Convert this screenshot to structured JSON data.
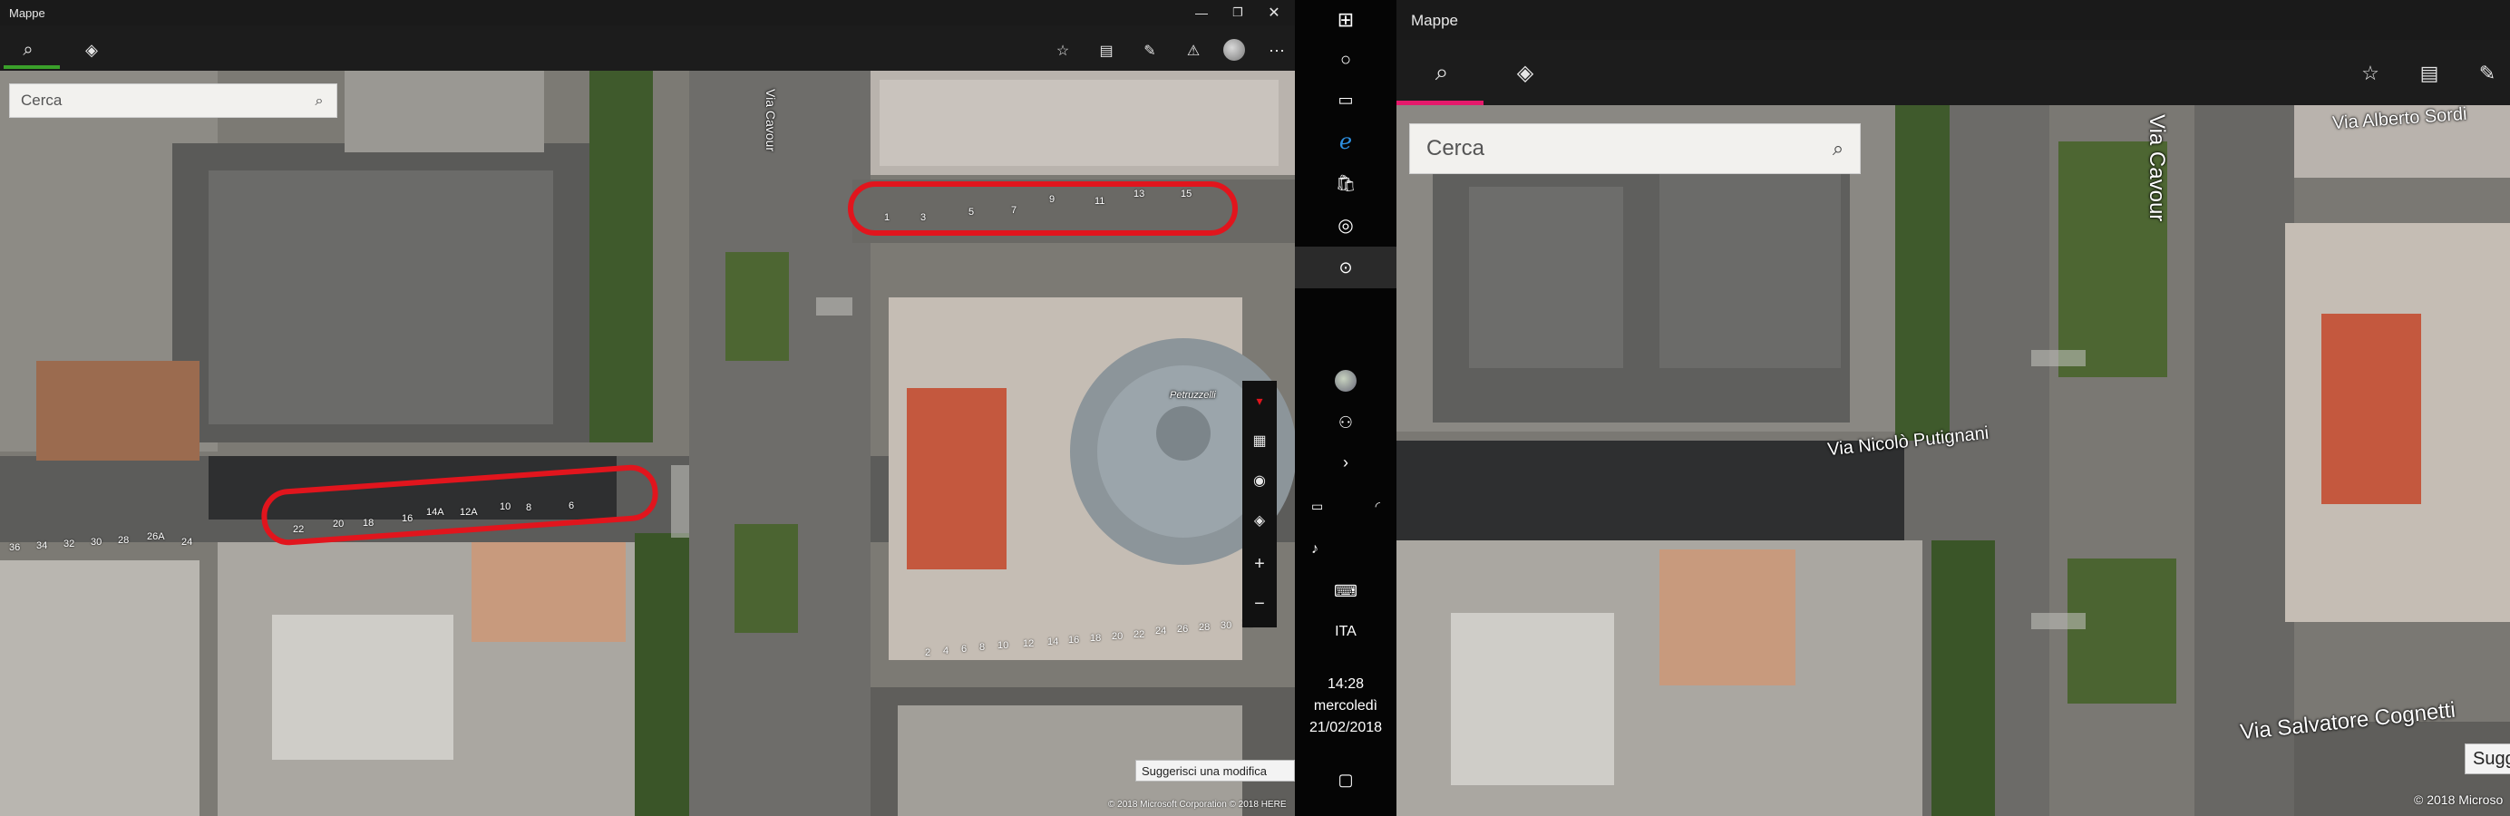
{
  "left_window": {
    "title": "Mappe",
    "search_placeholder": "Cerca",
    "street_label": "Via Cavour",
    "building_label": "Petruzzelli",
    "suggest_label": "Suggerisci una modifica",
    "copyright": "© 2018 Microsoft Corporation © 2018 HERE",
    "house_numbers_top": [
      "1",
      "3",
      "5",
      "7",
      "9",
      "11",
      "13",
      "15"
    ],
    "house_numbers_bottom": [
      "22",
      "20",
      "18",
      "16",
      "14A",
      "12A",
      "10",
      "8",
      "6"
    ],
    "house_numbers_row2": [
      "36",
      "34",
      "32",
      "30",
      "28",
      "26A",
      "24"
    ],
    "house_numbers_right": [
      "2",
      "4",
      "6",
      "8",
      "10",
      "12",
      "14",
      "16",
      "18",
      "20",
      "22",
      "24",
      "26",
      "28",
      "30",
      "32"
    ]
  },
  "taskbar": {
    "language": "ITA",
    "time": "14:28",
    "day": "mercoledì",
    "date": "21/02/2018"
  },
  "right_window": {
    "title": "Mappe",
    "search_placeholder": "Cerca",
    "street_labels": {
      "cavour": "Via Cavour",
      "sordi": "Via Alberto Sordi",
      "putignani": "Via Nicolò Putignani",
      "cognetti": "Via Salvatore Cognetti"
    },
    "suggest_label": "Sugg",
    "copyright": "© 2018 Microso"
  },
  "colors": {
    "accent_red": "#e1151d",
    "tab_underline": "#e5196b",
    "toolbar": "#1c1c1c"
  }
}
